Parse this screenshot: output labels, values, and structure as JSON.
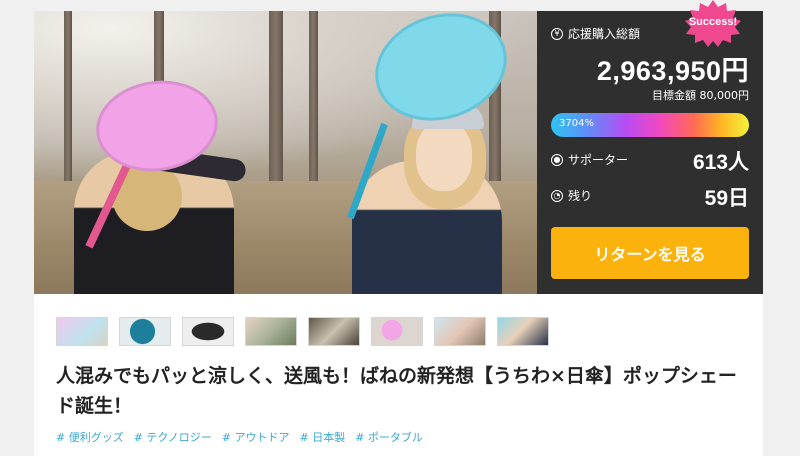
{
  "stats": {
    "total_label": "応援購入総額",
    "total_amount": "2,963,950円",
    "goal_text": "目標金額 80,000円",
    "progress_text": "3704%",
    "progress_percent": 3704,
    "supporters_label": "サポーター",
    "supporters_value": "613人",
    "remaining_label": "残り",
    "remaining_value": "59日",
    "cta_label": "リターンを見る",
    "badge_text": "Success!"
  },
  "colors": {
    "panel_bg": "#2f2f2f",
    "cta": "#fcb20c",
    "badge": "#f0488f",
    "tag": "#3aa8d4"
  },
  "project": {
    "title": "人混みでもパッと涼しく、送風も！ばねの新発想【うちわ×日傘】ポップシェード誕生！",
    "tags": [
      "# 便利グッズ",
      "# テクノロジー",
      "# アウトドア",
      "# 日本製",
      "# ポータブル"
    ]
  },
  "thumbnails": [
    {
      "name": "thumbnail-1"
    },
    {
      "name": "thumbnail-2"
    },
    {
      "name": "thumbnail-3"
    },
    {
      "name": "thumbnail-4"
    },
    {
      "name": "thumbnail-5"
    },
    {
      "name": "thumbnail-6"
    },
    {
      "name": "thumbnail-7"
    },
    {
      "name": "thumbnail-8"
    }
  ]
}
